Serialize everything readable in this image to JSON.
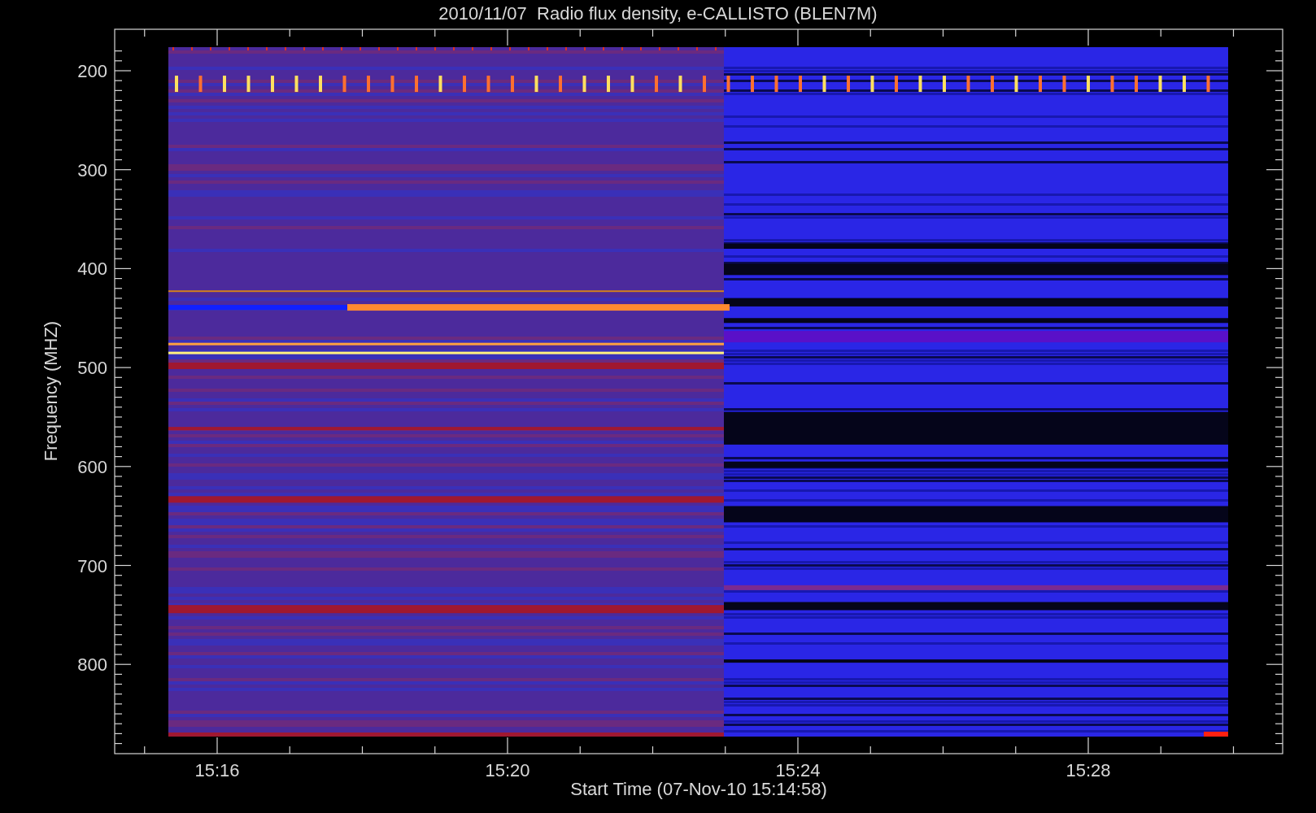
{
  "title": "2010/11/07  Radio flux density, e-CALLISTO (BLEN7M)",
  "plot": {
    "ylabel": "Frequency (MHZ)",
    "xlabel": "Start Time (07-Nov-10 15:14:58)",
    "yticks": [
      "200",
      "300",
      "400",
      "500",
      "600",
      "700",
      "800"
    ],
    "xticks": [
      "15:16",
      "15:20",
      "15:24",
      "15:28"
    ]
  }
}
